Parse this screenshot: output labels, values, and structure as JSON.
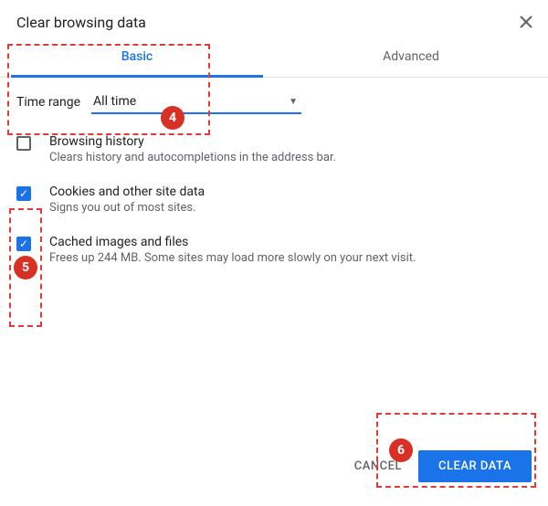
{
  "dialog": {
    "title": "Clear browsing data"
  },
  "tabs": {
    "basic": "Basic",
    "advanced": "Advanced"
  },
  "time_range": {
    "label": "Time range",
    "value": "All time"
  },
  "options": [
    {
      "title": "Browsing history",
      "desc": "Clears history and autocompletions in the address bar.",
      "checked": false
    },
    {
      "title": "Cookies and other site data",
      "desc": "Signs you out of most sites.",
      "checked": true
    },
    {
      "title": "Cached images and files",
      "desc": "Frees up 244 MB. Some sites may load more slowly on your next visit.",
      "checked": true
    }
  ],
  "actions": {
    "cancel": "CANCEL",
    "clear": "CLEAR DATA"
  },
  "annotations": {
    "badge4": "4",
    "badge5": "5",
    "badge6": "6"
  }
}
